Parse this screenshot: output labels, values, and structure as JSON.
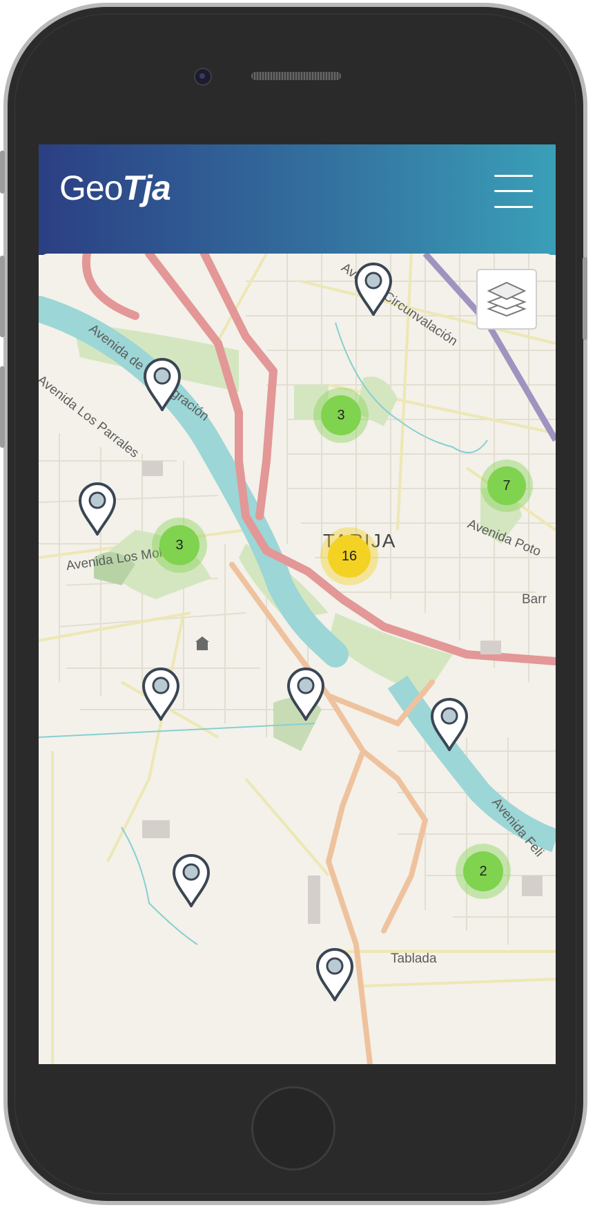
{
  "app": {
    "logo_light": "Geo",
    "logo_bold": "Tja"
  },
  "colors": {
    "navbar_start": "#2b3f83",
    "navbar_end": "#3a9fb8",
    "cluster_small": "#7fd34e",
    "cluster_medium": "#f3d224",
    "river": "#9cd6d6",
    "highway": "#e08c8c"
  },
  "map": {
    "city_label": "TARIJA",
    "street_labels": {
      "circunvalacion": "Avenida Circunvalación",
      "integracion": "Avenida de la Integración",
      "parrales": "Avenida Los Parrales",
      "molles": "Avenida Los Molles",
      "potosi": "Avenida Poto",
      "barrio": "Barr",
      "felipe": "Avenida Feli",
      "tablada": "Tablada"
    },
    "layers_icon": "layers-icon",
    "clusters": [
      {
        "count": "3",
        "level": "small"
      },
      {
        "count": "7",
        "level": "small"
      },
      {
        "count": "3",
        "level": "small"
      },
      {
        "count": "16",
        "level": "medium"
      },
      {
        "count": "2",
        "level": "small"
      }
    ],
    "marker_icon": "map-pin-icon",
    "marker_count": 9
  },
  "menu_icon": "hamburger-menu-icon"
}
